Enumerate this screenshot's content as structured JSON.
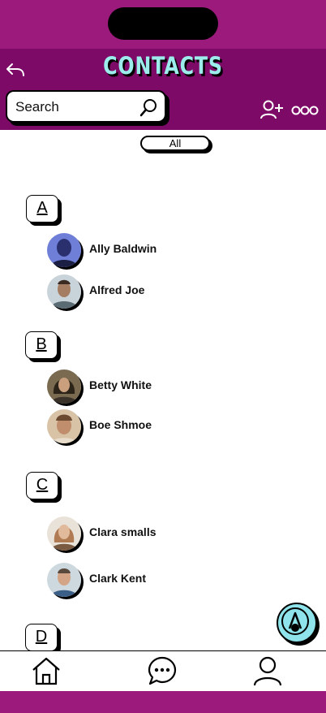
{
  "header": {
    "title": "CONTACTS"
  },
  "search": {
    "placeholder": "Search"
  },
  "filter": {
    "label": "All"
  },
  "sections": [
    {
      "letter": "A",
      "contacts": [
        {
          "name": "Ally Baldwin",
          "avatar_colors": [
            "#6f7fd8",
            "#2a2f6e"
          ]
        },
        {
          "name": "Alfred Joe",
          "avatar_colors": [
            "#c9d3da",
            "#5b6b74"
          ]
        }
      ]
    },
    {
      "letter": "B",
      "contacts": [
        {
          "name": "Betty White",
          "avatar_colors": [
            "#7a6a4f",
            "#2c2418"
          ]
        },
        {
          "name": "Boe Shmoe",
          "avatar_colors": [
            "#d8c3a6",
            "#6b4a32"
          ]
        }
      ]
    },
    {
      "letter": "C",
      "contacts": [
        {
          "name": "Clara smalls",
          "avatar_colors": [
            "#e9e2d8",
            "#b07a52"
          ]
        },
        {
          "name": "Clark Kent",
          "avatar_colors": [
            "#cdd8df",
            "#5a4a3e"
          ]
        }
      ]
    },
    {
      "letter": "D",
      "contacts": []
    }
  ],
  "colors": {
    "status_bar": "#9b1a7c",
    "header": "#7d0a66",
    "title": "#9cecec",
    "fab": "#8fe3ea"
  },
  "icons": {
    "back": "back-arrow-icon",
    "search": "search-icon",
    "add_user": "add-user-icon",
    "more": "more-icon",
    "compose": "compose-icon",
    "home": "home-icon",
    "chat": "chat-icon",
    "profile": "profile-icon"
  }
}
